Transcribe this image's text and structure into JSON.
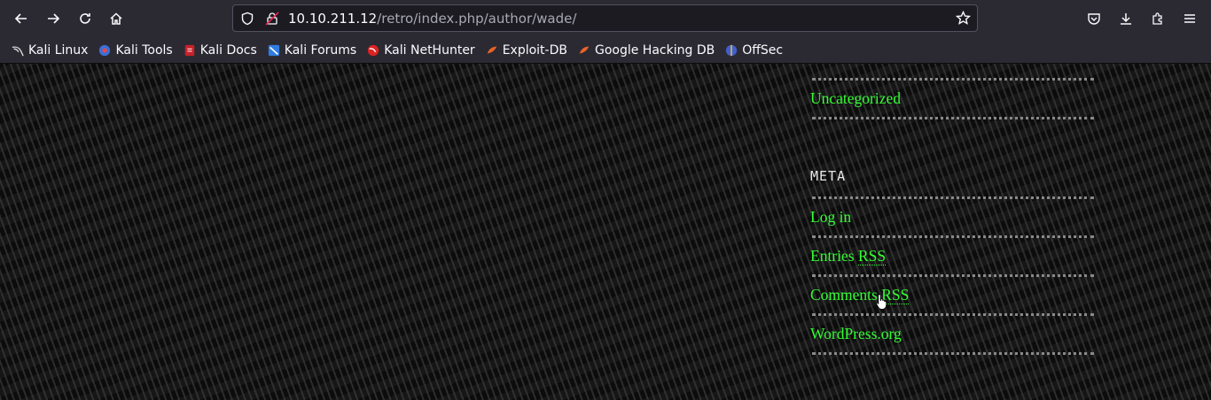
{
  "browser": {
    "url_host": "10.10.211.12",
    "url_path": "/retro/index.php/author/wade/",
    "bookmarks": [
      {
        "label": "Kali Linux",
        "icon": "kali-dragon-icon"
      },
      {
        "label": "Kali Tools",
        "icon": "kali-tools-icon"
      },
      {
        "label": "Kali Docs",
        "icon": "kali-docs-icon"
      },
      {
        "label": "Kali Forums",
        "icon": "kali-forums-icon"
      },
      {
        "label": "Kali NetHunter",
        "icon": "kali-nethunter-icon"
      },
      {
        "label": "Exploit-DB",
        "icon": "exploit-db-icon"
      },
      {
        "label": "Google Hacking DB",
        "icon": "ghdb-icon"
      },
      {
        "label": "OffSec",
        "icon": "offsec-icon"
      }
    ]
  },
  "sidebar": {
    "categories": {
      "item": "Uncategorized"
    },
    "meta": {
      "title": "META",
      "login": "Log in",
      "entries_prefix": "Entries ",
      "entries_abbr": "RSS",
      "comments_prefix": "Comments ",
      "comments_abbr": "RSS",
      "wordpress": "WordPress.org"
    }
  },
  "colors": {
    "link": "#33ff33",
    "chrome": "#2b2a33",
    "heading": "#e8e8e8"
  }
}
